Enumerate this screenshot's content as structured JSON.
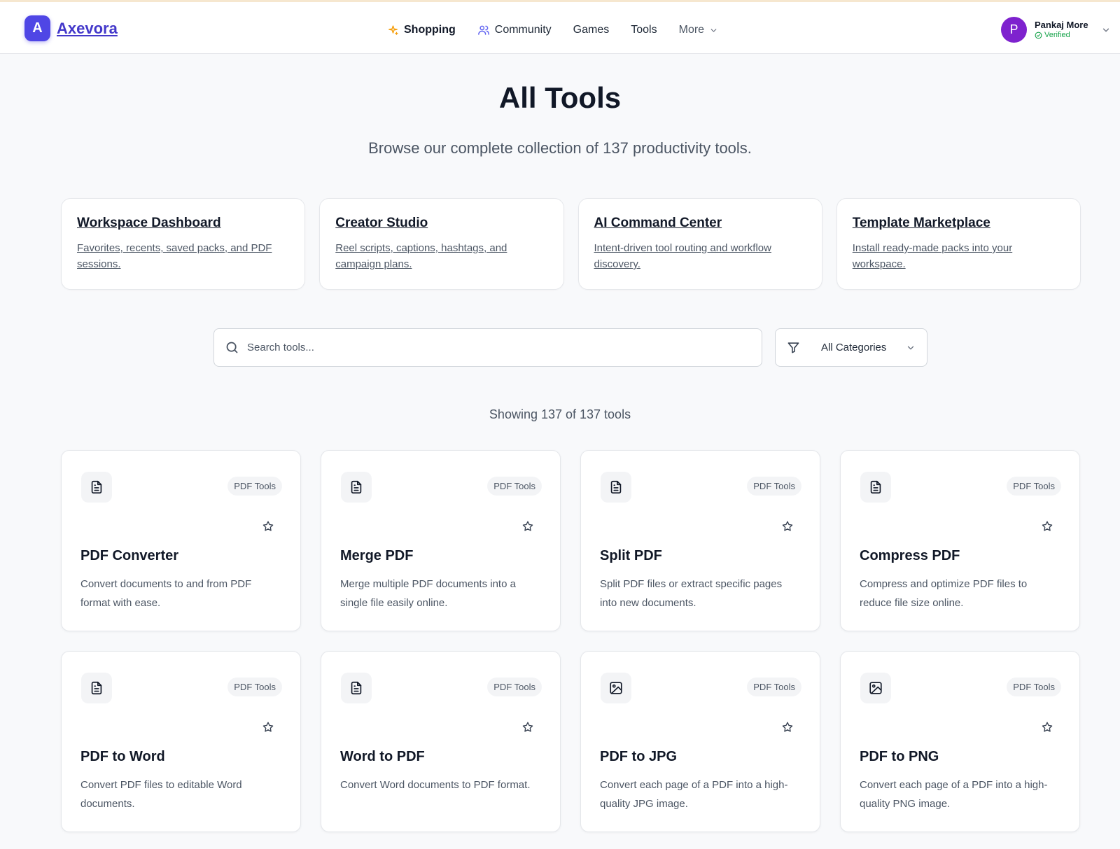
{
  "header": {
    "logo_letter": "A",
    "brand": "Axevora",
    "nav": [
      {
        "label": "Shopping",
        "icon": "sparkle-icon"
      },
      {
        "label": "Community",
        "icon": "users-icon"
      },
      {
        "label": "Games"
      },
      {
        "label": "Tools"
      },
      {
        "label": "More",
        "icon": "chevron-down-icon"
      }
    ],
    "user": {
      "initial": "P",
      "name": "Pankaj More",
      "status": "Verified"
    }
  },
  "page": {
    "title": "All Tools",
    "subtitle": "Browse our complete collection of 137 productivity tools."
  },
  "hubs": [
    {
      "title": "Workspace Dashboard",
      "desc": "Favorites, recents, saved packs, and PDF sessions."
    },
    {
      "title": "Creator Studio",
      "desc": "Reel scripts, captions, hashtags, and campaign plans."
    },
    {
      "title": "AI Command Center",
      "desc": "Intent-driven tool routing and workflow discovery."
    },
    {
      "title": "Template Marketplace",
      "desc": "Install ready-made packs into your workspace."
    }
  ],
  "search": {
    "placeholder": "Search tools...",
    "value": ""
  },
  "filter": {
    "selected": "All Categories"
  },
  "results": {
    "count_text": "Showing 137 of 137 tools"
  },
  "tools": [
    {
      "title": "PDF Converter",
      "desc": "Convert documents to and from PDF format with ease.",
      "category": "PDF Tools",
      "icon": "document-icon"
    },
    {
      "title": "Merge PDF",
      "desc": "Merge multiple PDF documents into a single file easily online.",
      "category": "PDF Tools",
      "icon": "document-icon"
    },
    {
      "title": "Split PDF",
      "desc": "Split PDF files or extract specific pages into new documents.",
      "category": "PDF Tools",
      "icon": "document-icon"
    },
    {
      "title": "Compress PDF",
      "desc": "Compress and optimize PDF files to reduce file size online.",
      "category": "PDF Tools",
      "icon": "document-icon"
    },
    {
      "title": "PDF to Word",
      "desc": "Convert PDF files to editable Word documents.",
      "category": "PDF Tools",
      "icon": "document-icon"
    },
    {
      "title": "Word to PDF",
      "desc": "Convert Word documents to PDF format.",
      "category": "PDF Tools",
      "icon": "document-icon"
    },
    {
      "title": "PDF to JPG",
      "desc": "Convert each page of a PDF into a high-quality JPG image.",
      "category": "PDF Tools",
      "icon": "image-icon"
    },
    {
      "title": "PDF to PNG",
      "desc": "Convert each page of a PDF into a high-quality PNG image.",
      "category": "PDF Tools",
      "icon": "image-icon"
    }
  ],
  "colors": {
    "brand": "#4f46e5",
    "avatar": "#7e22ce",
    "verified": "#16a34a"
  }
}
